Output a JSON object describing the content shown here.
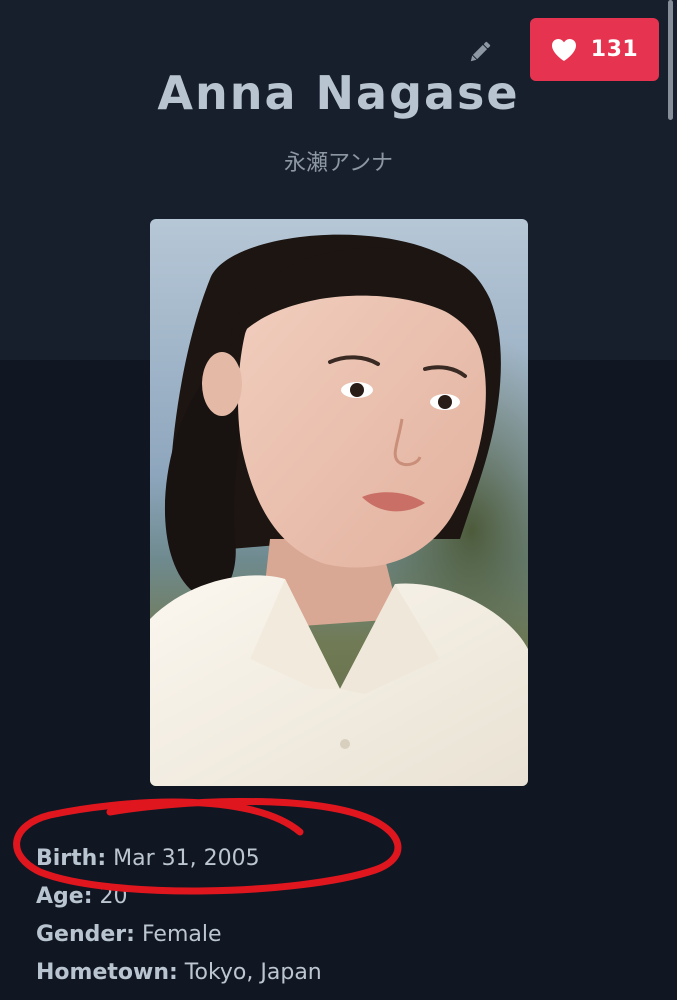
{
  "like_button": {
    "count": "131",
    "icon": "heart-icon"
  },
  "header": {
    "name": "Anna Nagase",
    "native_name": "永瀬アンナ",
    "edit_icon": "pencil-icon"
  },
  "profile_photo": {
    "icon": "portrait-photo"
  },
  "details": [
    {
      "label": "Birth:",
      "value": "Mar 31, 2005"
    },
    {
      "label": "Age:",
      "value": "20"
    },
    {
      "label": "Gender:",
      "value": "Female"
    },
    {
      "label": "Hometown:",
      "value": "Tokyo, Japan"
    }
  ],
  "colors": {
    "background": "#111722",
    "header_background": "#171f2d",
    "like_button": "#e6334f",
    "annotation_red": "#e0161f"
  }
}
